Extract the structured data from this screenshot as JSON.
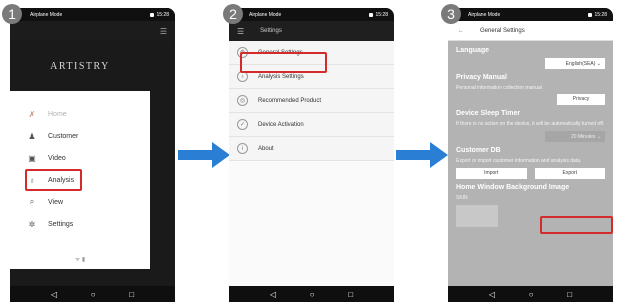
{
  "steps": [
    "1",
    "2",
    "3"
  ],
  "status": {
    "left": "Airplane Mode",
    "right": "15:28"
  },
  "phone1": {
    "brand": "ARTISTRY",
    "menu": [
      {
        "label": "Home",
        "icon": "home-icon",
        "glyph": "✗",
        "muted": true
      },
      {
        "label": "Customer",
        "icon": "customer-icon",
        "glyph": "♟",
        "muted": false
      },
      {
        "label": "Video",
        "icon": "video-icon",
        "glyph": "▣",
        "muted": false
      },
      {
        "label": "Analysis",
        "icon": "analysis-icon",
        "glyph": "♁",
        "muted": false
      },
      {
        "label": "View",
        "icon": "view-icon",
        "glyph": "⌕",
        "muted": false
      },
      {
        "label": "Settings",
        "icon": "gear-icon",
        "glyph": "✲",
        "muted": false
      }
    ]
  },
  "phone2": {
    "title": "Settings",
    "items": [
      {
        "label": "General Settings",
        "glyph": "⚙",
        "icon": "general-settings-icon"
      },
      {
        "label": "Analysis Settings",
        "glyph": "♁",
        "icon": "analysis-settings-icon"
      },
      {
        "label": "Recommended Product",
        "glyph": "◎",
        "icon": "recommended-product-icon"
      },
      {
        "label": "Device Activation",
        "glyph": "✓",
        "icon": "device-activation-icon"
      },
      {
        "label": "About",
        "glyph": "i",
        "icon": "about-icon"
      }
    ]
  },
  "phone3": {
    "title": "General Settings",
    "language": {
      "heading": "Language",
      "value": "English(SEA)"
    },
    "privacy": {
      "heading": "Privacy Manual",
      "text": "Personal information collection manual",
      "button": "Privacy"
    },
    "sleep": {
      "heading": "Device Sleep Timer",
      "text": "If there is no action on the device, it will be automatically turned off.",
      "value": "20 Minutes"
    },
    "customer_db": {
      "heading": "Customer DB",
      "text": "Export or import customer information and analysis data.",
      "import": "Import",
      "export": "Export"
    },
    "background": {
      "heading": "Home Window Background Image",
      "label": "SKIN"
    }
  },
  "colors": {
    "highlight": "#d42a2a",
    "arrow": "#2a7ed4"
  }
}
